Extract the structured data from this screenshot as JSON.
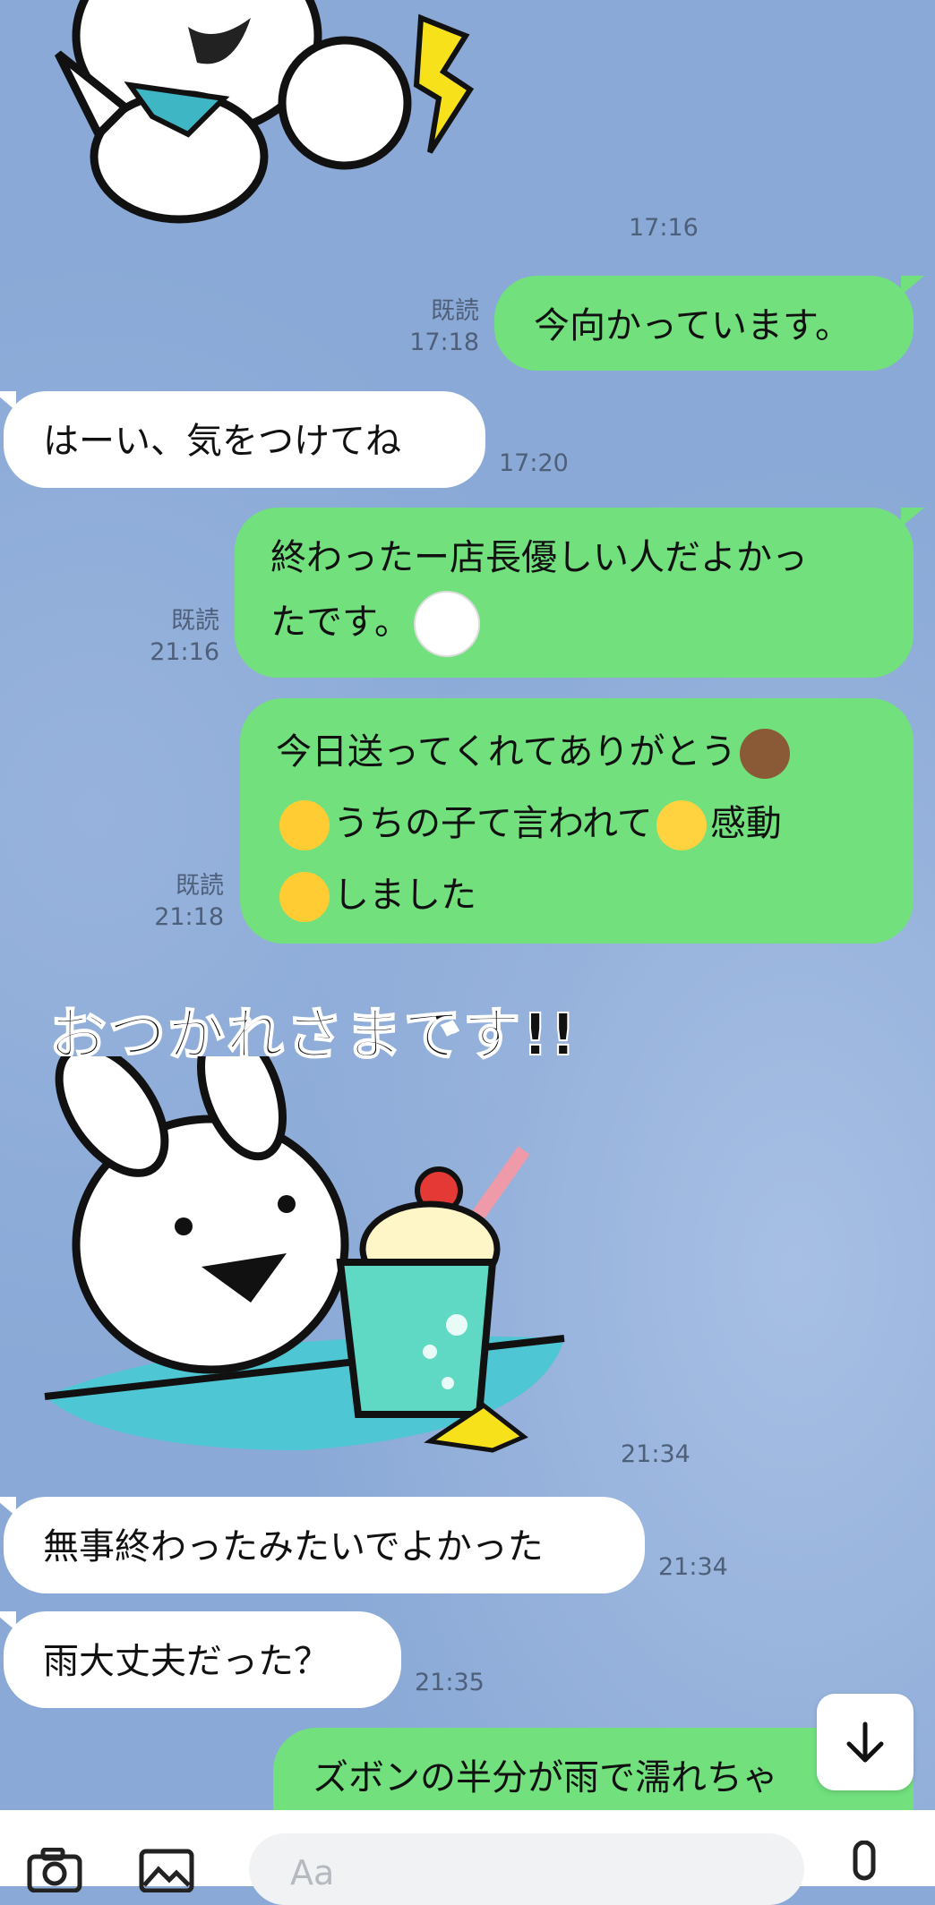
{
  "messages": [
    {
      "side": "in",
      "type": "sticker",
      "time": "17:16"
    },
    {
      "side": "out",
      "text": "今向かっています。",
      "read": "既読",
      "time": "17:18"
    },
    {
      "side": "in",
      "text": "はーい、気をつけてね",
      "time": "17:20"
    },
    {
      "side": "out",
      "lines": [
        "終わったー店長優しい人だよかっ",
        "たです。"
      ],
      "read": "既読",
      "time": "21:16"
    },
    {
      "side": "out",
      "lines": [
        "今日送ってくれてありがとう",
        "うちの子て言われて",
        "感動",
        "しました"
      ],
      "read": "既読",
      "time": "21:18"
    },
    {
      "side": "in",
      "type": "sticker",
      "caption": "おつかれさまです!!",
      "time": "21:34"
    },
    {
      "side": "in",
      "text": "無事終わったみたいでよかった",
      "time": "21:34"
    },
    {
      "side": "in",
      "text": "雨大丈夫だった？",
      "time": "21:35"
    },
    {
      "side": "out",
      "text": "ズボンの半分が雨で濡れちゃ"
    }
  ],
  "input": {
    "placeholder": "Aa"
  },
  "icons": [
    "camera-icon",
    "image-icon",
    "ai-icon",
    "emoji-icon",
    "mic-icon",
    "arrow-down-icon"
  ],
  "colors": {
    "background": "#8aa9d6",
    "outgoing": "#71e07d",
    "incoming": "#ffffff"
  }
}
